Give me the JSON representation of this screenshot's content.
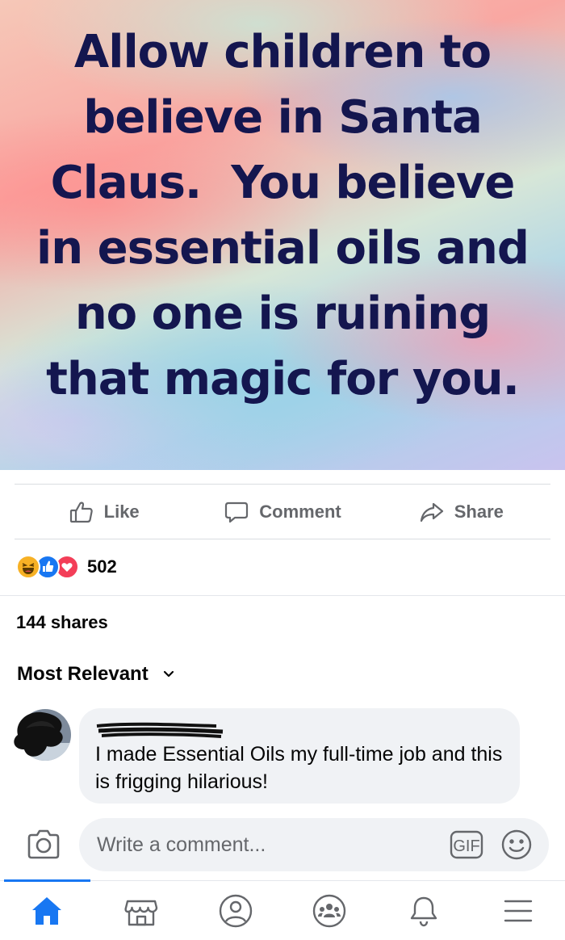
{
  "post": {
    "quote_lines": [
      "Allow children to",
      "believe in Santa",
      "Claus.  You believe",
      "in essential oils and",
      "no one is ruining",
      "that magic for you."
    ]
  },
  "actions": {
    "like_label": "Like",
    "comment_label": "Comment",
    "share_label": "Share"
  },
  "reactions": {
    "icons": [
      "haha-icon",
      "like-icon",
      "love-icon"
    ],
    "count": "502"
  },
  "shares_text": "144 shares",
  "sort_label": "Most Relevant",
  "comment": {
    "text": "I made Essential Oils my full-time job and this is frigging hilarious!"
  },
  "composer": {
    "placeholder": "Write a comment...",
    "gif_label": "GIF"
  },
  "nav": {
    "items": [
      "home-icon",
      "marketplace-icon",
      "profile-icon",
      "groups-icon",
      "notifications-icon",
      "menu-icon"
    ],
    "active": "home-icon"
  },
  "colors": {
    "quote_text": "#14164f",
    "accent": "#1877f2",
    "secondary_text": "#65676b",
    "bubble_bg": "#f0f2f5"
  }
}
